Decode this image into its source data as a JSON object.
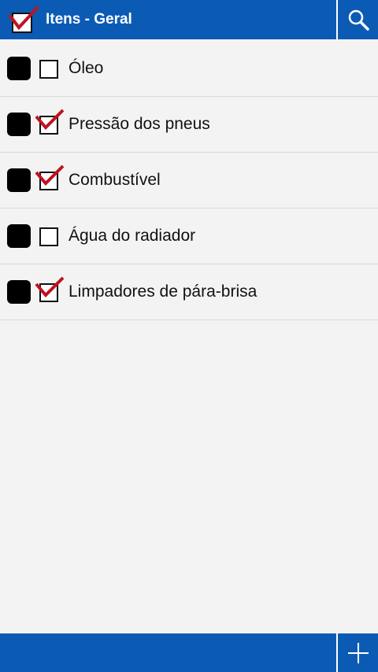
{
  "header": {
    "title": "Itens - Geral",
    "icon": "checklist-logo-icon",
    "search_icon": "search-icon"
  },
  "items": [
    {
      "label": "Óleo",
      "checked": false
    },
    {
      "label": "Pressão dos pneus",
      "checked": true
    },
    {
      "label": "Combustível",
      "checked": true
    },
    {
      "label": "Água do radiador",
      "checked": false
    },
    {
      "label": "Limpadores de pára-brisa",
      "checked": true
    }
  ],
  "footer": {
    "add_icon": "plus-icon"
  },
  "colors": {
    "bar": "#0b5bb5",
    "background": "#f3f3f3",
    "check": "#c0121f"
  }
}
